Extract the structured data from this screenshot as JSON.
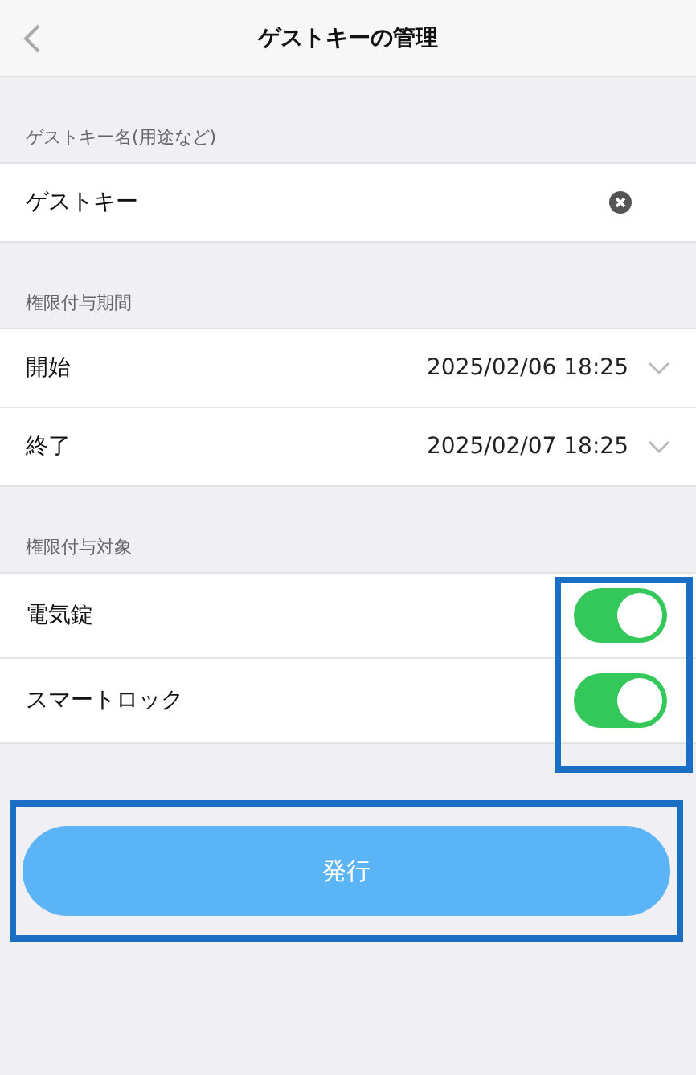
{
  "header": {
    "title": "ゲストキーの管理"
  },
  "name_section": {
    "label": "ゲストキー名(用途など)",
    "value": "ゲストキー"
  },
  "period_section": {
    "label": "権限付与期間",
    "rows": [
      {
        "label": "開始",
        "value": "2025/02/06 18:25"
      },
      {
        "label": "終了",
        "value": "2025/02/07 18:25"
      }
    ]
  },
  "target_section": {
    "label": "権限付与対象",
    "highlighted": true,
    "rows": [
      {
        "label": "電気錠",
        "on": true
      },
      {
        "label": "スマートロック",
        "on": true
      }
    ]
  },
  "issue_button": {
    "label": "発行",
    "highlighted": true
  }
}
